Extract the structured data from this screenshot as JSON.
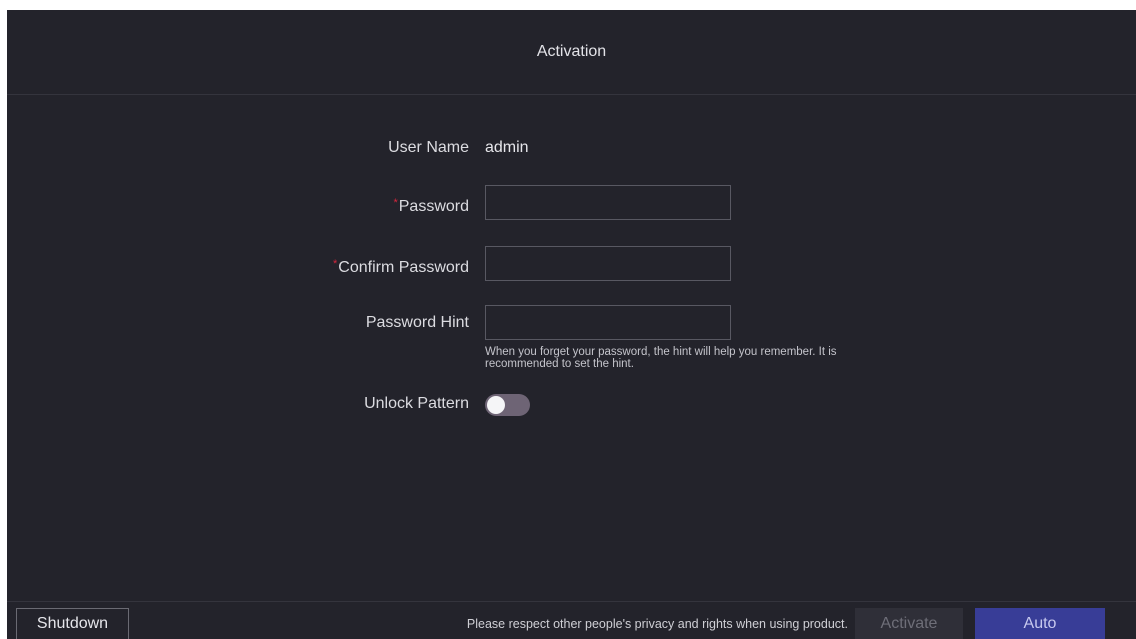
{
  "window": {
    "title": "Activation"
  },
  "form": {
    "username": {
      "label": "User Name",
      "value": "admin"
    },
    "password": {
      "required_mark": "*",
      "label": "Password",
      "value": ""
    },
    "confirm_password": {
      "required_mark": "*",
      "label": "Confirm Password",
      "value": ""
    },
    "password_hint": {
      "label": "Password Hint",
      "value": "",
      "help_text_line1": "When you forget your password, the hint will help you remember. It is",
      "help_text_line2": "recommended to set the hint."
    },
    "unlock_pattern": {
      "label": "Unlock Pattern",
      "enabled": false
    }
  },
  "footer": {
    "shutdown_label": "Shutdown",
    "notice": "Please respect other people's privacy and rights when using product.",
    "activate_label": "Activate",
    "auto_label": "Auto"
  },
  "colors": {
    "background": "#23232b",
    "required": "#d7263d",
    "primary_button": "#383d97",
    "toggle_off": "#6e6475"
  }
}
